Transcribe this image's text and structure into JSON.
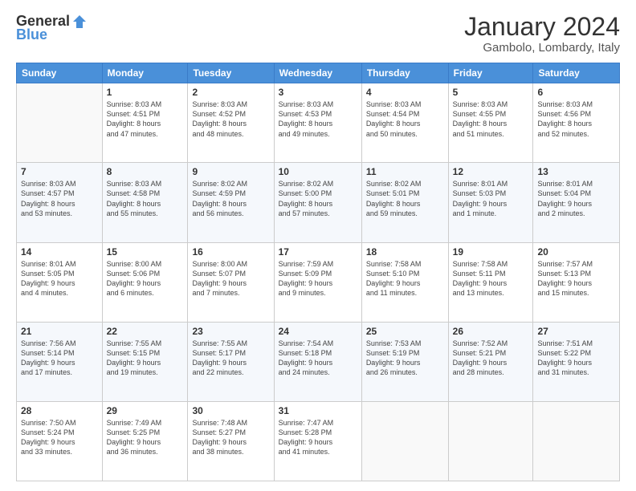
{
  "logo": {
    "general": "General",
    "blue": "Blue"
  },
  "header": {
    "month": "January 2024",
    "location": "Gambolo, Lombardy, Italy"
  },
  "weekdays": [
    "Sunday",
    "Monday",
    "Tuesday",
    "Wednesday",
    "Thursday",
    "Friday",
    "Saturday"
  ],
  "weeks": [
    [
      {
        "day": "",
        "info": ""
      },
      {
        "day": "1",
        "info": "Sunrise: 8:03 AM\nSunset: 4:51 PM\nDaylight: 8 hours\nand 47 minutes."
      },
      {
        "day": "2",
        "info": "Sunrise: 8:03 AM\nSunset: 4:52 PM\nDaylight: 8 hours\nand 48 minutes."
      },
      {
        "day": "3",
        "info": "Sunrise: 8:03 AM\nSunset: 4:53 PM\nDaylight: 8 hours\nand 49 minutes."
      },
      {
        "day": "4",
        "info": "Sunrise: 8:03 AM\nSunset: 4:54 PM\nDaylight: 8 hours\nand 50 minutes."
      },
      {
        "day": "5",
        "info": "Sunrise: 8:03 AM\nSunset: 4:55 PM\nDaylight: 8 hours\nand 51 minutes."
      },
      {
        "day": "6",
        "info": "Sunrise: 8:03 AM\nSunset: 4:56 PM\nDaylight: 8 hours\nand 52 minutes."
      }
    ],
    [
      {
        "day": "7",
        "info": "Sunrise: 8:03 AM\nSunset: 4:57 PM\nDaylight: 8 hours\nand 53 minutes."
      },
      {
        "day": "8",
        "info": "Sunrise: 8:03 AM\nSunset: 4:58 PM\nDaylight: 8 hours\nand 55 minutes."
      },
      {
        "day": "9",
        "info": "Sunrise: 8:02 AM\nSunset: 4:59 PM\nDaylight: 8 hours\nand 56 minutes."
      },
      {
        "day": "10",
        "info": "Sunrise: 8:02 AM\nSunset: 5:00 PM\nDaylight: 8 hours\nand 57 minutes."
      },
      {
        "day": "11",
        "info": "Sunrise: 8:02 AM\nSunset: 5:01 PM\nDaylight: 8 hours\nand 59 minutes."
      },
      {
        "day": "12",
        "info": "Sunrise: 8:01 AM\nSunset: 5:03 PM\nDaylight: 9 hours\nand 1 minute."
      },
      {
        "day": "13",
        "info": "Sunrise: 8:01 AM\nSunset: 5:04 PM\nDaylight: 9 hours\nand 2 minutes."
      }
    ],
    [
      {
        "day": "14",
        "info": "Sunrise: 8:01 AM\nSunset: 5:05 PM\nDaylight: 9 hours\nand 4 minutes."
      },
      {
        "day": "15",
        "info": "Sunrise: 8:00 AM\nSunset: 5:06 PM\nDaylight: 9 hours\nand 6 minutes."
      },
      {
        "day": "16",
        "info": "Sunrise: 8:00 AM\nSunset: 5:07 PM\nDaylight: 9 hours\nand 7 minutes."
      },
      {
        "day": "17",
        "info": "Sunrise: 7:59 AM\nSunset: 5:09 PM\nDaylight: 9 hours\nand 9 minutes."
      },
      {
        "day": "18",
        "info": "Sunrise: 7:58 AM\nSunset: 5:10 PM\nDaylight: 9 hours\nand 11 minutes."
      },
      {
        "day": "19",
        "info": "Sunrise: 7:58 AM\nSunset: 5:11 PM\nDaylight: 9 hours\nand 13 minutes."
      },
      {
        "day": "20",
        "info": "Sunrise: 7:57 AM\nSunset: 5:13 PM\nDaylight: 9 hours\nand 15 minutes."
      }
    ],
    [
      {
        "day": "21",
        "info": "Sunrise: 7:56 AM\nSunset: 5:14 PM\nDaylight: 9 hours\nand 17 minutes."
      },
      {
        "day": "22",
        "info": "Sunrise: 7:55 AM\nSunset: 5:15 PM\nDaylight: 9 hours\nand 19 minutes."
      },
      {
        "day": "23",
        "info": "Sunrise: 7:55 AM\nSunset: 5:17 PM\nDaylight: 9 hours\nand 22 minutes."
      },
      {
        "day": "24",
        "info": "Sunrise: 7:54 AM\nSunset: 5:18 PM\nDaylight: 9 hours\nand 24 minutes."
      },
      {
        "day": "25",
        "info": "Sunrise: 7:53 AM\nSunset: 5:19 PM\nDaylight: 9 hours\nand 26 minutes."
      },
      {
        "day": "26",
        "info": "Sunrise: 7:52 AM\nSunset: 5:21 PM\nDaylight: 9 hours\nand 28 minutes."
      },
      {
        "day": "27",
        "info": "Sunrise: 7:51 AM\nSunset: 5:22 PM\nDaylight: 9 hours\nand 31 minutes."
      }
    ],
    [
      {
        "day": "28",
        "info": "Sunrise: 7:50 AM\nSunset: 5:24 PM\nDaylight: 9 hours\nand 33 minutes."
      },
      {
        "day": "29",
        "info": "Sunrise: 7:49 AM\nSunset: 5:25 PM\nDaylight: 9 hours\nand 36 minutes."
      },
      {
        "day": "30",
        "info": "Sunrise: 7:48 AM\nSunset: 5:27 PM\nDaylight: 9 hours\nand 38 minutes."
      },
      {
        "day": "31",
        "info": "Sunrise: 7:47 AM\nSunset: 5:28 PM\nDaylight: 9 hours\nand 41 minutes."
      },
      {
        "day": "",
        "info": ""
      },
      {
        "day": "",
        "info": ""
      },
      {
        "day": "",
        "info": ""
      }
    ]
  ]
}
